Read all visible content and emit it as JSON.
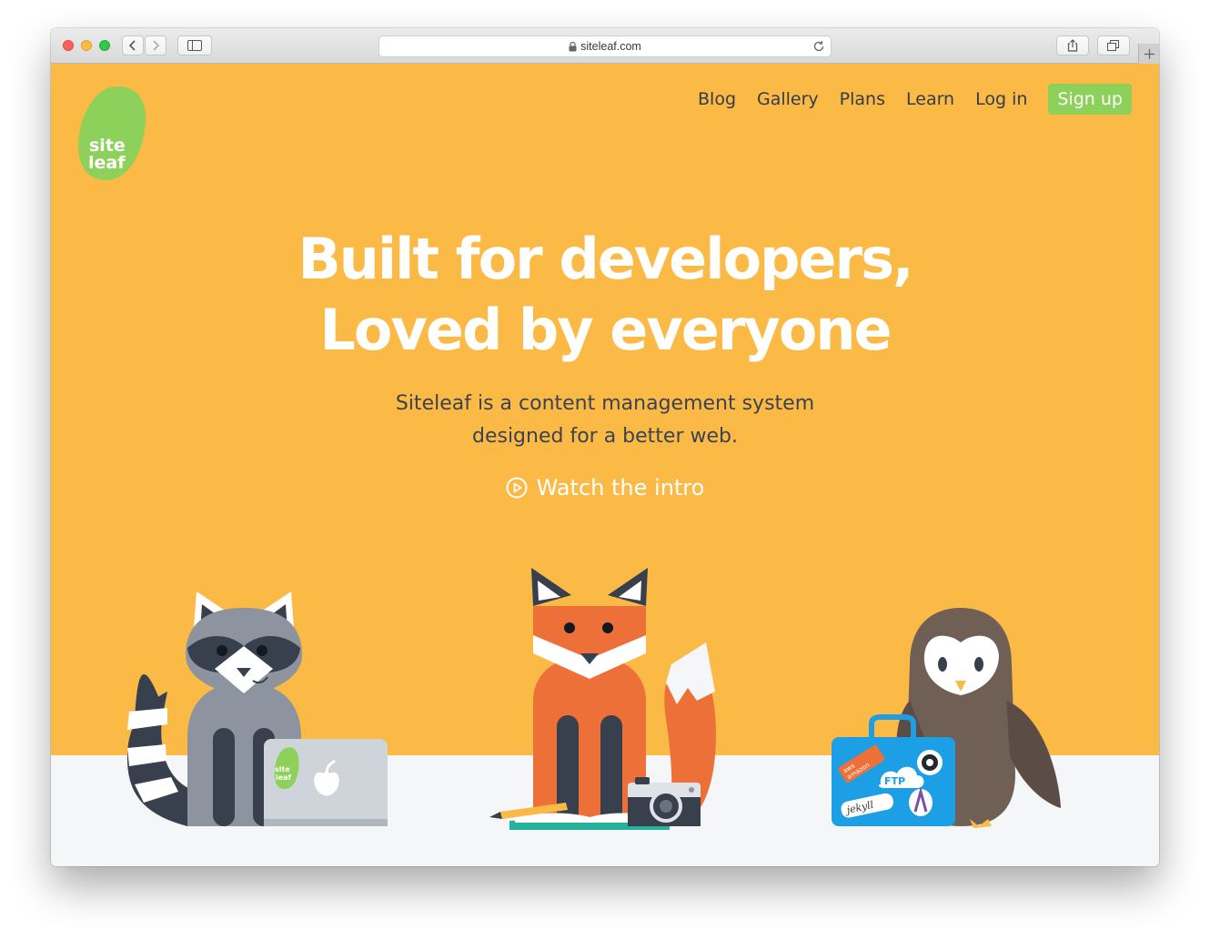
{
  "browser": {
    "url": "siteleaf.com"
  },
  "logo": {
    "line1": "site",
    "line2": "leaf"
  },
  "nav": {
    "items": [
      {
        "label": "Blog"
      },
      {
        "label": "Gallery"
      },
      {
        "label": "Plans"
      },
      {
        "label": "Learn"
      },
      {
        "label": "Log in"
      }
    ],
    "signup": "Sign up"
  },
  "hero": {
    "title_line1": "Built for developers,",
    "title_line2": "Loved by everyone",
    "subtitle_line1": "Siteleaf is a content management system",
    "subtitle_line2": "designed for a better web.",
    "intro_link": "Watch the intro"
  },
  "illustration": {
    "laptop_sticker_line1": "site",
    "laptop_sticker_line2": "leaf",
    "suitcase_sticker_ftp": "FTP",
    "suitcase_sticker_jekyll": "jekyll",
    "suitcase_sticker_aws_line1": "aws",
    "suitcase_sticker_aws_line2": "amazon"
  },
  "colors": {
    "hero_background": "#fbb945",
    "floor": "#f5f6f8",
    "brand_green": "#8ed15a",
    "nav_text": "#333c4a",
    "fox": "#ee7039",
    "raccoon": "#8e949f",
    "owl": "#6f5f55",
    "suitcase": "#1d9fe6"
  }
}
